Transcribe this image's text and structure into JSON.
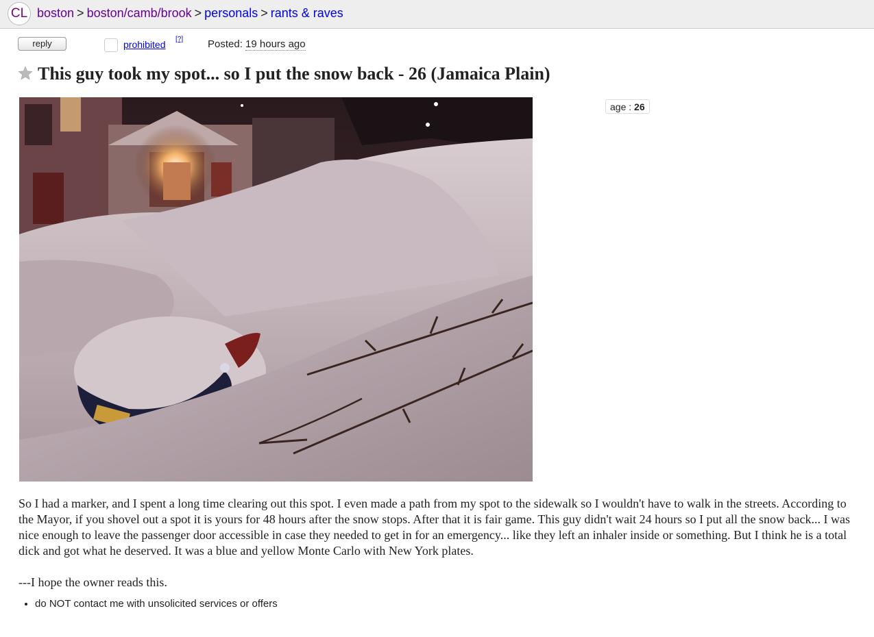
{
  "header": {
    "logo": "CL",
    "breadcrumbs": [
      {
        "label": "boston",
        "visited": true
      },
      {
        "label": "boston/camb/brook",
        "visited": true
      },
      {
        "label": "personals",
        "visited": false
      },
      {
        "label": "rants & raves",
        "visited": false
      }
    ],
    "separator": ">"
  },
  "toolbar": {
    "reply_label": "reply",
    "prohibited_label": "prohibited",
    "help_label": "[?]",
    "posted_label": "Posted:",
    "posted_time": "19 hours ago"
  },
  "post": {
    "title": "This guy took my spot... so I put the snow back - 26 (Jamaica Plain)",
    "star_icon": "star-icon",
    "attributes": {
      "age_label": "age :",
      "age_value": "26"
    },
    "body_paragraph": "So I had a marker, and I spent a long time clearing out this spot. I even made a path from my spot to the sidewalk so I wouldn't have to walk in the streets. According to the Mayor, if you shovel out a spot it is yours for 48 hours after the snow stops. After that it is fair game. This guy didn't wait 24 hours so I put all the snow back... I was nice enough to leave the passenger door accessible in case they needed to get in for an emergency... like they left an inhaler inside or something. But I think he is a total dick and got what he deserved. It was a blue and yellow Monte Carlo with New York plates.",
    "body_closing": "---I hope the owner reads this.",
    "notices": [
      "do NOT contact me with unsolicited services or offers"
    ]
  },
  "colors": {
    "visited_link": "#660099",
    "link": "#0000ee",
    "topbar_bg": "#eeeeee"
  }
}
